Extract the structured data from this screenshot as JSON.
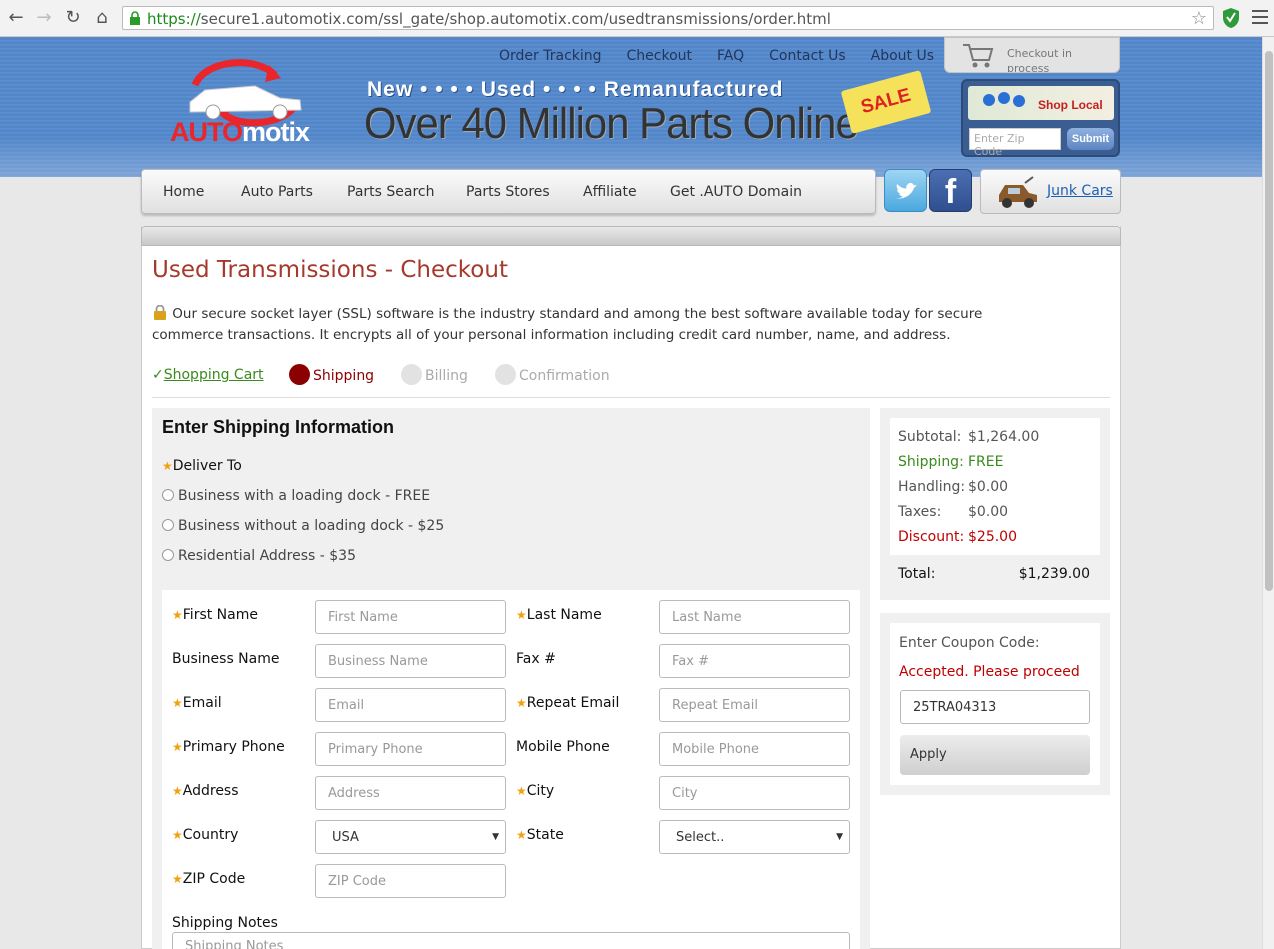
{
  "browser": {
    "url_prefix": "https://",
    "url_rest": "secure1.automotix.com/ssl_gate/shop.automotix.com/usedtransmissions/order.html"
  },
  "header": {
    "logo_a": "AUTO",
    "logo_b": "motix",
    "tagline_top": "New  • • • •  Used  • • • •  Remanufactured",
    "tagline_main": "Over 40 Million Parts Online",
    "sale": "SALE",
    "top_links": [
      "Order Tracking",
      "Checkout",
      "FAQ",
      "Contact Us",
      "About Us"
    ],
    "cart_status": "Checkout in process",
    "shop_local": "Shop Local",
    "zip_placeholder": "Enter Zip Code",
    "zip_submit": "Submit"
  },
  "nav": {
    "items": [
      "Home",
      "Auto Parts",
      "Parts Search",
      "Parts Stores",
      "Affiliate",
      "Get .AUTO Domain"
    ],
    "junk_cars": "Junk Cars"
  },
  "page": {
    "title": "Used Transmissions - Checkout",
    "ssl_text": "Our secure socket layer (SSL) software is the industry standard and among the best software available today for secure commerce transactions. It encrypts all of your personal information including credit card number, name, and address."
  },
  "steps": [
    {
      "label": "Shopping Cart",
      "state": "done"
    },
    {
      "label": "Shipping",
      "state": "active"
    },
    {
      "label": "Billing",
      "state": "pending"
    },
    {
      "label": "Confirmation",
      "state": "pending"
    }
  ],
  "shipping": {
    "heading": "Enter Shipping Information",
    "deliver_to": "Deliver To",
    "options": [
      "Business with a loading dock - FREE",
      "Business without a loading dock - $25",
      "Residential Address - $35"
    ],
    "fields": {
      "first_name": {
        "label": "First Name",
        "placeholder": "First Name"
      },
      "last_name": {
        "label": "Last Name",
        "placeholder": "Last Name"
      },
      "business_name": {
        "label": "Business Name",
        "placeholder": "Business Name"
      },
      "fax": {
        "label": "Fax #",
        "placeholder": "Fax #"
      },
      "email": {
        "label": "Email",
        "placeholder": "Email"
      },
      "repeat_email": {
        "label": "Repeat Email",
        "placeholder": "Repeat Email"
      },
      "primary_phone": {
        "label": "Primary Phone",
        "placeholder": "Primary Phone"
      },
      "mobile_phone": {
        "label": "Mobile Phone",
        "placeholder": "Mobile Phone"
      },
      "address": {
        "label": "Address",
        "placeholder": "Address"
      },
      "city": {
        "label": "City",
        "placeholder": "City"
      },
      "country": {
        "label": "Country",
        "value": "USA"
      },
      "state": {
        "label": "State",
        "value": "Select.."
      },
      "zip": {
        "label": "ZIP Code",
        "placeholder": "ZIP Code"
      },
      "notes": {
        "label": "Shipping Notes",
        "placeholder": "Shipping Notes"
      }
    }
  },
  "summary": {
    "subtotal_label": "Subtotal:",
    "subtotal": "$1,264.00",
    "shipping_label": "Shipping:",
    "shipping": "FREE",
    "handling_label": "Handling:",
    "handling": "$0.00",
    "taxes_label": "Taxes:",
    "taxes": "$0.00",
    "discount_label": "Discount:",
    "discount": "$25.00",
    "total_label": "Total:",
    "total": "$1,239.00"
  },
  "coupon": {
    "label": "Enter Coupon Code:",
    "status": "Accepted. Please proceed",
    "code": "25TRA04313",
    "apply": "Apply"
  },
  "colors": {
    "title_red": "#a53a2c",
    "accepted_red": "#c00000",
    "green": "#3a8a1e",
    "active_step": "#8b0000",
    "required_star": "#f0a20e"
  }
}
